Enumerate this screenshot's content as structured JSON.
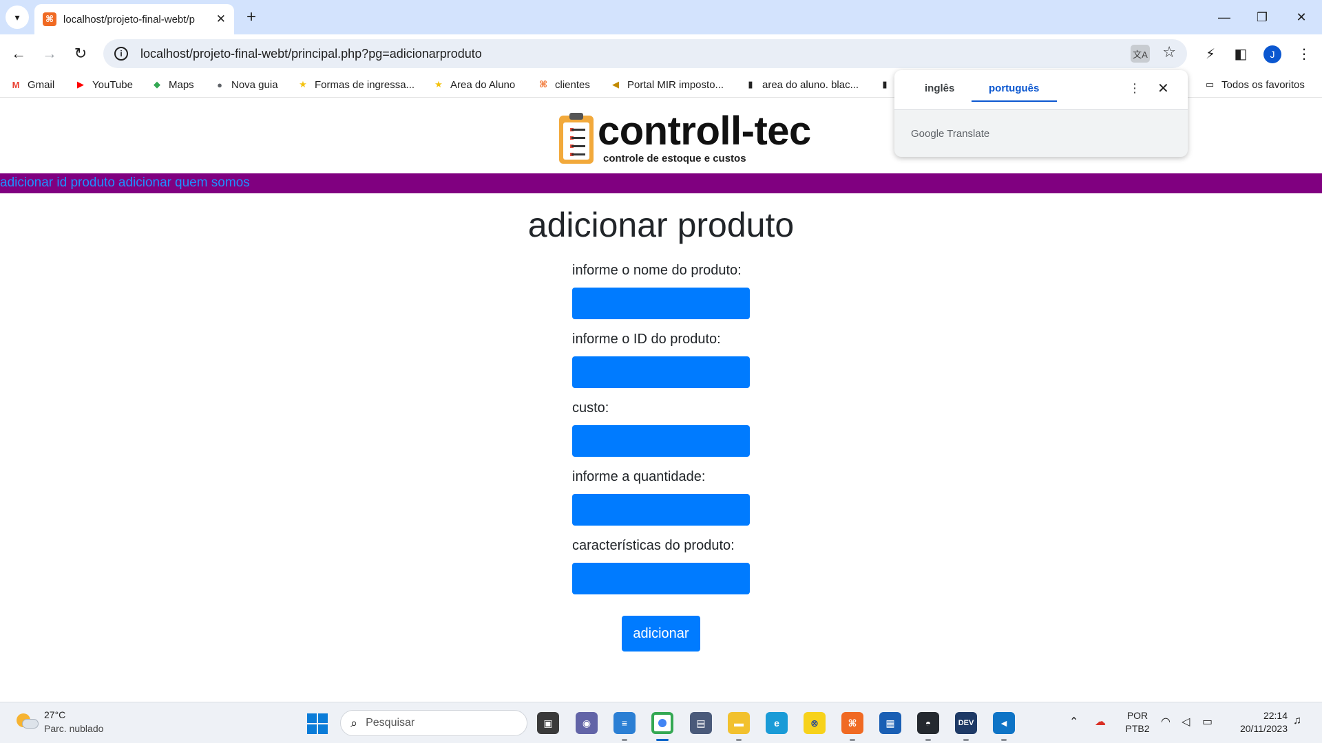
{
  "browser": {
    "tab_title": "localhost/projeto-final-webt/p",
    "url": "localhost/projeto-final-webt/principal.php?pg=adicionarproduto",
    "profile_initial": "J",
    "bookmarks": [
      {
        "label": "Gmail",
        "icon": "gmail-icon",
        "color": "#ea4335",
        "glyph": "M"
      },
      {
        "label": "YouTube",
        "icon": "youtube-icon",
        "color": "#ff0000",
        "glyph": "▶"
      },
      {
        "label": "Maps",
        "icon": "maps-icon",
        "color": "#34a853",
        "glyph": "◆"
      },
      {
        "label": "Nova guia",
        "icon": "globe-icon",
        "color": "#5f6368",
        "glyph": "●"
      },
      {
        "label": "Formas de ingressa...",
        "icon": "star-bookmark-icon",
        "color": "#f4c20d",
        "glyph": "★"
      },
      {
        "label": "Area do Aluno",
        "icon": "star-bookmark-icon",
        "color": "#f4c20d",
        "glyph": "★"
      },
      {
        "label": "clientes",
        "icon": "xampp-icon",
        "color": "#f06a23",
        "glyph": "⌘"
      },
      {
        "label": "Portal MIR imposto...",
        "icon": "portal-icon",
        "color": "#c28a00",
        "glyph": "◀"
      },
      {
        "label": "area do aluno. blac...",
        "icon": "chart-bookmark-icon",
        "color": "#222222",
        "glyph": "▮"
      },
      {
        "label": "Todos os favoritos",
        "icon": "folder-icon",
        "color": "#1f1f1f",
        "glyph": "▭"
      }
    ]
  },
  "translate_popup": {
    "source_lang": "inglês",
    "target_lang": "português",
    "brand": "Google Translate"
  },
  "site": {
    "logo_title": "controll-tec",
    "logo_subtitle": "controle de estoque e custos",
    "nav_links": [
      "adicionar id produto",
      "adicionar",
      "quem somos"
    ],
    "colors": {
      "navbar": "#800080",
      "nav_link": "#1e90ff",
      "input": "#007bff",
      "button": "#007bff"
    }
  },
  "form": {
    "heading": "adicionar produto",
    "fields": [
      {
        "label": "informe o nome do produto:",
        "value": ""
      },
      {
        "label": "informe o ID do produto:",
        "value": ""
      },
      {
        "label": "custo:",
        "value": ""
      },
      {
        "label": "informe a quantidade:",
        "value": ""
      },
      {
        "label": "características do produto:",
        "value": ""
      }
    ],
    "submit_label": "adicionar"
  },
  "taskbar": {
    "weather_temp": "27°C",
    "weather_desc": "Parc. nublado",
    "search_placeholder": "Pesquisar",
    "lang_line1": "POR",
    "lang_line2": "PTB2",
    "time": "22:14",
    "date": "20/11/2023"
  }
}
